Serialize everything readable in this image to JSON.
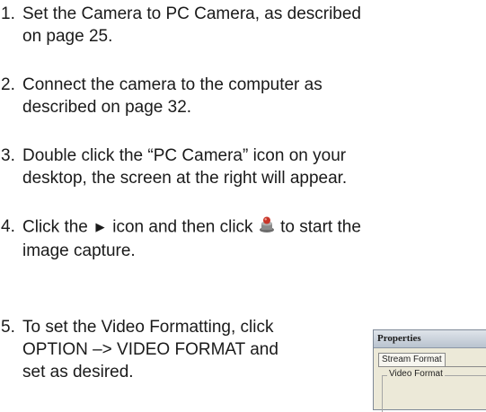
{
  "steps": [
    {
      "number": "1.",
      "line1": "Set the Camera to PC Camera, as described",
      "line2": "on page 25."
    },
    {
      "number": "2.",
      "line1": "Connect the camera to the computer as",
      "line2": "described on page 32."
    },
    {
      "number": "3.",
      "line1": "Double click the “PC Camera” icon on your",
      "line2": "desktop, the screen at the right will appear."
    },
    {
      "number": "4.",
      "line1_a": "Click the ",
      "play_glyph": "►",
      "line1_b": " icon and then click ",
      "line1_c": " to start the",
      "line2": "image capture."
    },
    {
      "number": "5.",
      "line1": "To set the Video Formatting, click",
      "line2": "OPTION –> VIDEO FORMAT and",
      "line3": "set as desired."
    }
  ],
  "properties_dialog": {
    "title": "Properties",
    "tab_label": "Stream Format",
    "group_label": "Video Format"
  },
  "colors": {
    "text": "#1a1a1a",
    "capture_icon_red": "#c8362a",
    "capture_icon_gray": "#6b6b6b"
  },
  "icons": {
    "play": "play-icon",
    "capture": "capture-icon"
  }
}
